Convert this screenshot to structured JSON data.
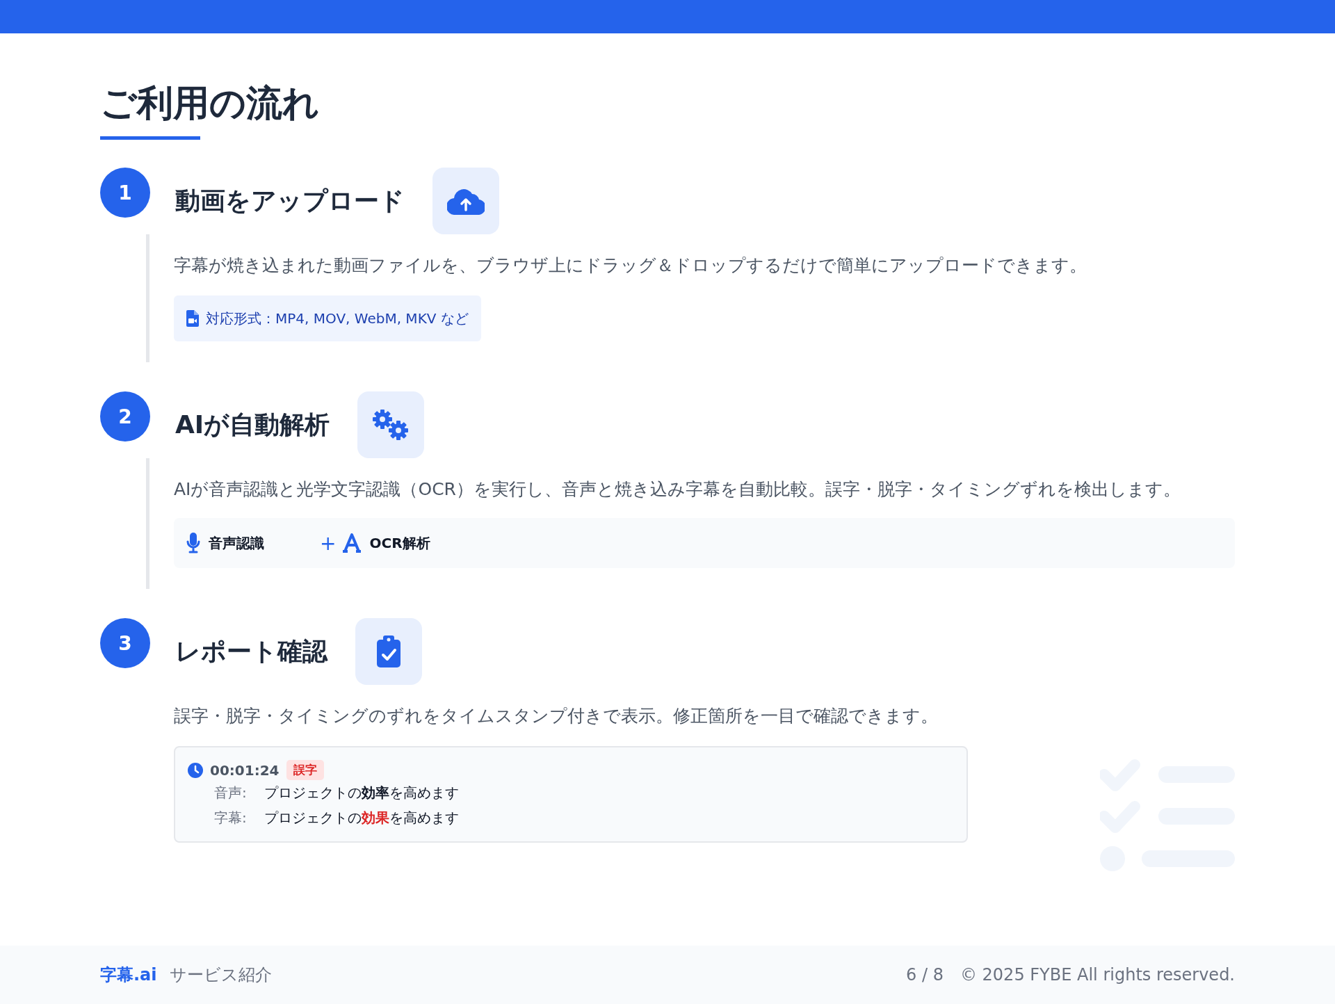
{
  "title": "ご利用の流れ",
  "steps": [
    {
      "number": "1",
      "title": "動画をアップロード",
      "description": "字幕が焼き込まれた動画ファイルを、ブラウザ上にドラッグ＆ドロップするだけで簡単にアップロードできます。",
      "format_tag": "対応形式：MP4, MOV, WebM, MKV など"
    },
    {
      "number": "2",
      "title": "AIが自動解析",
      "description": "AIが音声認識と光学文字認識（OCR）を実行し、音声と焼き込み字幕を自動比較。誤字・脱字・タイミングずれを検出します。",
      "methods": {
        "first": "音声認識",
        "joiner": "+",
        "second": "OCR解析"
      }
    },
    {
      "number": "3",
      "title": "レポート確認",
      "description": "誤字・脱字・タイミングのずれをタイムスタンプ付きで表示。修正箇所を一目で確認できます。",
      "report": {
        "time": "00:01:24",
        "badge": "誤字",
        "lines": [
          {
            "label": "音声:",
            "text": "プロジェクトの**効率**を高めます",
            "kind": "reference"
          },
          {
            "label": "字幕:",
            "text": "プロジェクトの**効果**を高めます",
            "kind": "error"
          }
        ]
      }
    }
  ],
  "footer": {
    "brand": "字幕.ai",
    "subtitle": "サービス紹介",
    "page": "6 / 8",
    "copyright": "© 2025 FYBE All rights reserved."
  }
}
